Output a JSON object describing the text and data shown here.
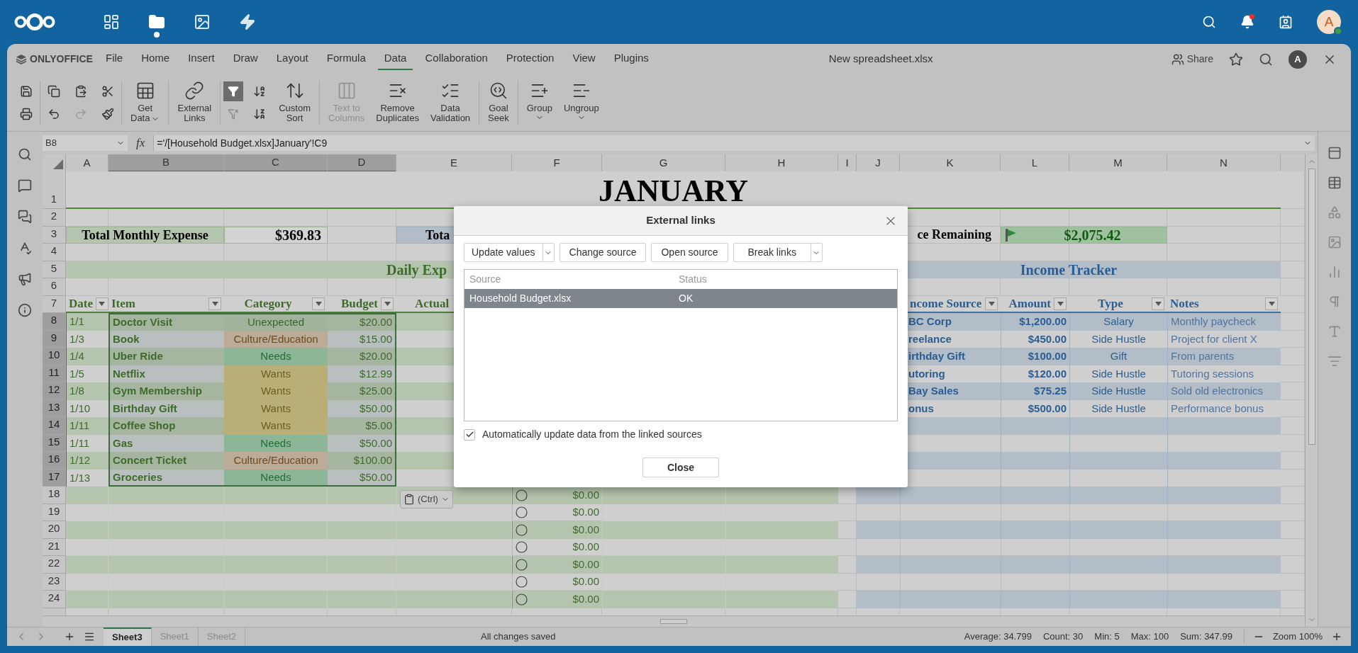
{
  "top_bar": {
    "apps": [
      {
        "kind": "dashboard",
        "selected": false
      },
      {
        "kind": "files",
        "selected": true
      },
      {
        "kind": "photos",
        "selected": false
      },
      {
        "kind": "activity",
        "selected": false
      }
    ],
    "notifications": true,
    "avatar": "A",
    "online": true
  },
  "editor": {
    "logo": "ONLYOFFICE",
    "menu": [
      {
        "label": "File",
        "selected": false
      },
      {
        "label": "Home",
        "selected": false
      },
      {
        "label": "Insert",
        "selected": false
      },
      {
        "label": "Draw",
        "selected": false
      },
      {
        "label": "Layout",
        "selected": false
      },
      {
        "label": "Formula",
        "selected": false
      },
      {
        "label": "Data",
        "selected": true
      },
      {
        "label": "Collaboration",
        "selected": false
      },
      {
        "label": "Protection",
        "selected": false
      },
      {
        "label": "View",
        "selected": false
      },
      {
        "label": "Plugins",
        "selected": false
      }
    ],
    "document_title": "New spreadsheet.xlsx",
    "share": "Share",
    "avatar": "A"
  },
  "toolbar": {
    "redo_disabled": true,
    "filter_on": true,
    "large_buttons": [
      {
        "kind": "get_data",
        "label": "Get\nData",
        "caret": true,
        "disabled": false
      },
      {
        "kind": "external_links",
        "label": "External\nLinks",
        "disabled": false
      },
      {
        "kind": "custom_sort",
        "label": "Custom\nSort",
        "disabled": false
      },
      {
        "kind": "text_to_columns",
        "label": "Text to\nColumns",
        "disabled": true
      },
      {
        "kind": "remove_duplicates",
        "label": "Remove\nDuplicates",
        "disabled": false
      },
      {
        "kind": "data_validation",
        "label": "Data\nValidation",
        "disabled": false
      },
      {
        "kind": "goal_seek",
        "label": "Goal\nSeek",
        "disabled": false
      },
      {
        "kind": "group",
        "label": "Group",
        "dropdown": true,
        "disabled": false
      },
      {
        "kind": "ungroup",
        "label": "Ungroup",
        "dropdown": true,
        "disabled": false
      }
    ]
  },
  "formula_bar": {
    "cell": "B8",
    "function_label": "fx",
    "formula": "='/[Household Budget.xlsx]January'!C9"
  },
  "sheet": {
    "columns": [
      {
        "label": "A",
        "selected": false
      },
      {
        "label": "B",
        "selected": true
      },
      {
        "label": "C",
        "selected": true
      },
      {
        "label": "D",
        "selected": true
      },
      {
        "label": "E",
        "selected": false
      },
      {
        "label": "F",
        "selected": false
      },
      {
        "label": "G",
        "selected": false
      },
      {
        "label": "H",
        "selected": false
      },
      {
        "label": "I",
        "selected": false
      },
      {
        "label": "J",
        "selected": false
      },
      {
        "label": "K",
        "selected": false
      },
      {
        "label": "L",
        "selected": false
      },
      {
        "label": "M",
        "selected": false
      },
      {
        "label": "N",
        "selected": false
      }
    ],
    "rows": [
      {
        "number": "1",
        "selected": false
      },
      {
        "number": "2",
        "selected": false
      },
      {
        "number": "3",
        "selected": false
      },
      {
        "number": "4",
        "selected": false
      },
      {
        "number": "5",
        "selected": false
      },
      {
        "number": "6",
        "selected": false
      },
      {
        "number": "7",
        "selected": false
      },
      {
        "number": "8",
        "selected": true
      },
      {
        "number": "9",
        "selected": true
      },
      {
        "number": "10",
        "selected": true
      },
      {
        "number": "11",
        "selected": true
      },
      {
        "number": "12",
        "selected": true
      },
      {
        "number": "13",
        "selected": true
      },
      {
        "number": "14",
        "selected": true
      },
      {
        "number": "15",
        "selected": true
      },
      {
        "number": "16",
        "selected": true
      },
      {
        "number": "17",
        "selected": true
      },
      {
        "number": "18",
        "selected": false
      },
      {
        "number": "19",
        "selected": false
      },
      {
        "number": "20",
        "selected": false
      },
      {
        "number": "21",
        "selected": false
      },
      {
        "number": "22",
        "selected": false
      },
      {
        "number": "23",
        "selected": false
      },
      {
        "number": "24",
        "selected": false
      }
    ],
    "title": "JANUARY",
    "total_expense": {
      "label": "Total Monthly Expense",
      "value": "$369.83"
    },
    "total_income": {
      "label": "Tota"
    },
    "balance": {
      "label": "ce Remaining",
      "value": "$2,075.42"
    },
    "expenses": {
      "title": "Daily Exp",
      "headers": [
        {
          "label": "Date",
          "filter": true
        },
        {
          "label": "Item",
          "filter": true
        },
        {
          "label": "Category",
          "filter": true
        },
        {
          "label": "Budget",
          "filter": true
        },
        {
          "label": "Actual",
          "filter": false
        }
      ],
      "rows": [
        {
          "date": "1/1",
          "item": "Doctor Visit",
          "category": "Unexpected",
          "color": "#a2b29d",
          "budget": "$20.00"
        },
        {
          "date": "1/3",
          "item": "Book",
          "category": "Culture/Education",
          "color": "#bcab97",
          "budget": "$15.00"
        },
        {
          "date": "1/4",
          "item": "Uber Ride",
          "category": "Needs",
          "color": "#8db597",
          "budget": "$20.00"
        },
        {
          "date": "1/5",
          "item": "Netflix",
          "category": "Wants",
          "color": "#b9ae75",
          "budget": "$12.99"
        },
        {
          "date": "1/8",
          "item": "Gym Membership",
          "category": "Wants",
          "color": "#b9ae75",
          "budget": "$25.00"
        },
        {
          "date": "1/10",
          "item": "Birthday Gift",
          "category": "Wants",
          "color": "#b9ae75",
          "budget": "$50.00"
        },
        {
          "date": "1/11",
          "item": "Coffee Shop",
          "category": "Wants",
          "color": "#b9ae75",
          "budget": "$5.00"
        },
        {
          "date": "1/11",
          "item": "Gas",
          "category": "Needs",
          "color": "#8db597",
          "budget": "$50.00"
        },
        {
          "date": "1/12",
          "item": "Concert Ticket",
          "category": "Culture/Education",
          "color": "#bcab97",
          "budget": "$100.00"
        },
        {
          "date": "1/13",
          "item": "Groceries",
          "category": "Needs",
          "color": "#8db597",
          "budget": "$50.00"
        }
      ]
    },
    "income": {
      "title": "Income Tracker",
      "headers": [
        {
          "label": "ncome Source",
          "filter": true
        },
        {
          "label": "Amount",
          "filter": true
        },
        {
          "label": "Type",
          "filter": true
        },
        {
          "label": "Notes",
          "filter": true
        }
      ],
      "rows": [
        {
          "source": "BC Corp",
          "amount": "$1,200.00",
          "type": "Salary",
          "notes": "Monthly paycheck"
        },
        {
          "source": "reelance",
          "amount": "$450.00",
          "type": "Side Hustle",
          "notes": "Project for client X"
        },
        {
          "source": "irthday Gift",
          "amount": "$100.00",
          "type": "Gift",
          "notes": "From parents"
        },
        {
          "source": "utoring",
          "amount": "$120.00",
          "type": "Side Hustle",
          "notes": "Tutoring sessions"
        },
        {
          "source": "Bay Sales",
          "amount": "$75.25",
          "type": "Side Hustle",
          "notes": "Sold old electronics"
        },
        {
          "source": "onus",
          "amount": "$500.00",
          "type": "Side Hustle",
          "notes": "Performance bonus"
        }
      ]
    },
    "tracker": [
      {
        "checked": false,
        "amount": "$0.00"
      },
      {
        "checked": false,
        "amount": "$0.00"
      },
      {
        "checked": false,
        "amount": "$0.00"
      },
      {
        "checked": false,
        "amount": "$0.00"
      },
      {
        "checked": false,
        "amount": "$0.00"
      },
      {
        "checked": false,
        "amount": "$0.00"
      },
      {
        "checked": false,
        "amount": "$0.00"
      }
    ],
    "paste_options": "(Ctrl)"
  },
  "dialog": {
    "title": "External links",
    "buttons": [
      {
        "label": "Update values",
        "split": true
      },
      {
        "label": "Change source",
        "split": false
      },
      {
        "label": "Open source",
        "split": false
      },
      {
        "label": "Break links",
        "split": true
      }
    ],
    "columns": [
      "Source",
      "Status"
    ],
    "rows": [
      {
        "source": "Household Budget.xlsx",
        "status": "OK",
        "selected": true
      }
    ],
    "auto_update": {
      "label": "Automatically update data from the linked sources",
      "checked": true
    },
    "close": "Close"
  },
  "status_bar": {
    "sheets": [
      {
        "label": "Sheet3",
        "selected": true
      },
      {
        "label": "Sheet1",
        "selected": false
      },
      {
        "label": "Sheet2",
        "selected": false
      }
    ],
    "status": "All changes saved",
    "stats": [
      "Average: 34.799",
      "Count: 30",
      "Min: 5",
      "Max: 100",
      "Sum: 347.99"
    ],
    "zoom": "Zoom 100%"
  }
}
